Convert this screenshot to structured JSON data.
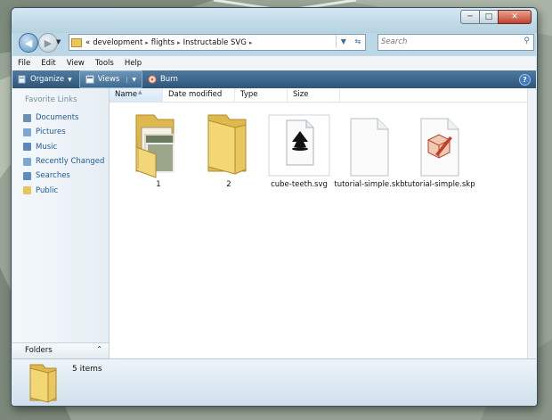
{
  "window": {
    "controls": {
      "minimize": "─",
      "maximize": "□",
      "close": "✕"
    }
  },
  "navigation": {
    "back": "◀",
    "forward": "▶",
    "address": {
      "overflow": "«",
      "crumbs": [
        "development",
        "flights",
        "Instructable SVG"
      ],
      "separator": "▸"
    },
    "search_placeholder": "Search"
  },
  "menu": [
    "File",
    "Edit",
    "View",
    "Tools",
    "Help"
  ],
  "toolbar": {
    "organize": "Organize",
    "views": "Views",
    "burn": "Burn",
    "help": "?"
  },
  "favorites": {
    "title": "Favorite Links",
    "items": [
      {
        "label": "Documents",
        "icon": "documents-icon",
        "color": "#6e8fb5"
      },
      {
        "label": "Pictures",
        "icon": "pictures-icon",
        "color": "#7aa7d4"
      },
      {
        "label": "Music",
        "icon": "music-icon",
        "color": "#5d86c0"
      },
      {
        "label": "Recently Changed",
        "icon": "recent-icon",
        "color": "#7aa7d4"
      },
      {
        "label": "Searches",
        "icon": "searches-icon",
        "color": "#5b8cc4"
      },
      {
        "label": "Public",
        "icon": "public-folder-icon",
        "color": "#e8c55a"
      }
    ],
    "folders_label": "Folders",
    "folders_chevron": "⌃"
  },
  "columns": [
    "Name",
    "Date modified",
    "Type",
    "Size"
  ],
  "files": [
    {
      "name": "1",
      "icon": "folder-icon",
      "type": "folder-photos"
    },
    {
      "name": "2",
      "icon": "folder-icon",
      "type": "folder"
    },
    {
      "name": "cube-teeth.svg",
      "icon": "inkscape-file-icon",
      "type": "inkscape"
    },
    {
      "name": "tutorial-simple.skb",
      "icon": "blank-file-icon",
      "type": "blank"
    },
    {
      "name": "tutorial-simple.skp",
      "icon": "sketchup-file-icon",
      "type": "sketchup"
    }
  ],
  "status": {
    "count": "5 items"
  },
  "colors": {
    "accent": "#2e5578",
    "link": "#1e5b9b",
    "folder": "#f0cf6a"
  }
}
